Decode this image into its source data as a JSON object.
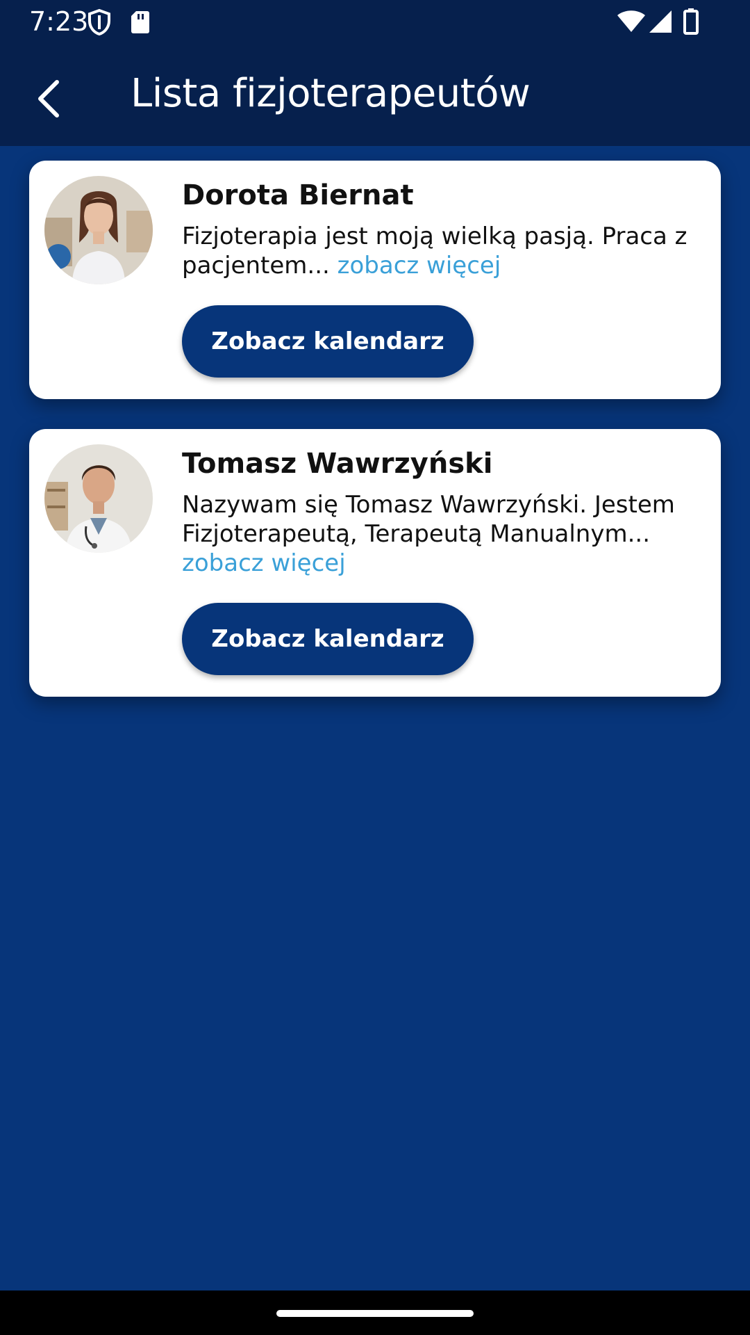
{
  "status_bar": {
    "time": "7:23",
    "icons": [
      "shield-icon",
      "sd-card-icon",
      "wifi-icon",
      "signal-icon",
      "battery-icon"
    ]
  },
  "app_bar": {
    "back_icon": "arrow-back-icon",
    "title": "Lista fizjoterapeutów"
  },
  "therapists": [
    {
      "name": "Dorota Biernat",
      "description": "Fizjoterapia jest moją wielką pasją. Praca z pacjentem...",
      "see_more": "zobacz więcej",
      "button_label": "Zobacz kalendarz"
    },
    {
      "name": "Tomasz Wawrzyński",
      "description": "Nazywam się Tomasz Wawrzyński. Jestem Fizjoterapeutą, Terapeutą Manualnym...",
      "see_more": "zobacz więcej",
      "button_label": "Zobacz kalendarz"
    }
  ],
  "colors": {
    "background": "#07357a",
    "app_bar": "#06204d",
    "link": "#3aa0d8",
    "button": "#07357a"
  }
}
